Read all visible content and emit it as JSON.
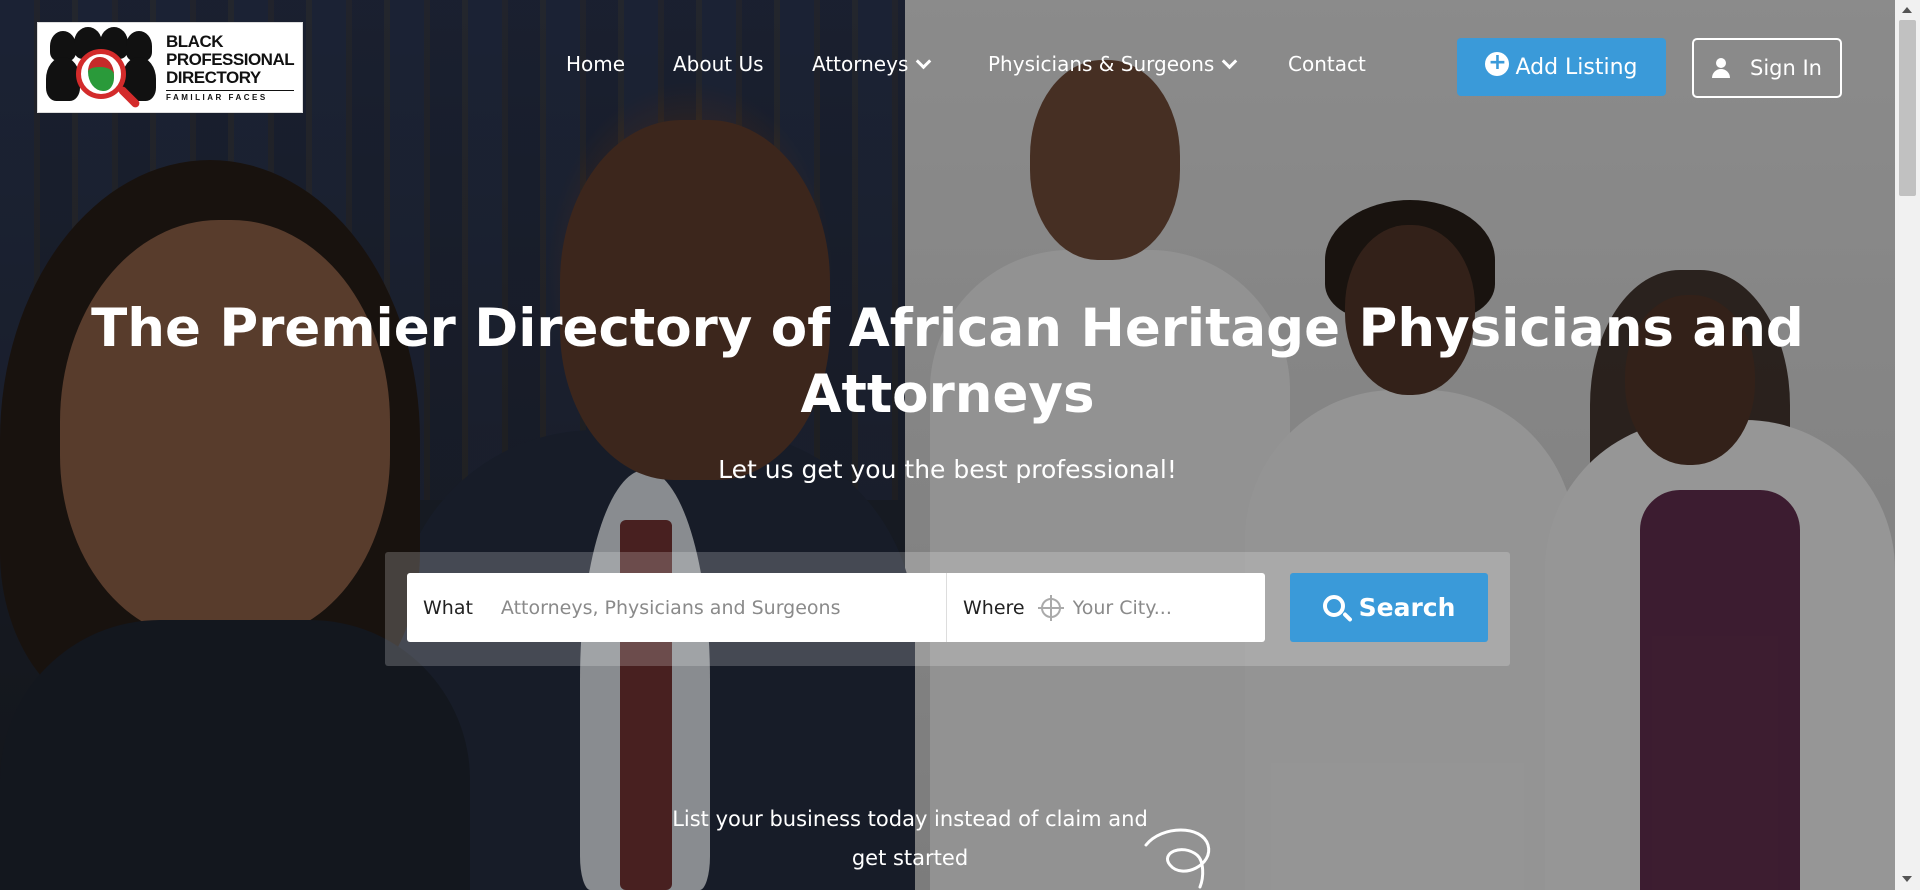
{
  "logo": {
    "line1": "BLACK",
    "line2": "PROFESSIONAL",
    "line3": "DIRECTORY",
    "line4": "FAMILIAR FACES"
  },
  "nav": {
    "items": [
      {
        "label": "Home",
        "dropdown": false
      },
      {
        "label": "About Us",
        "dropdown": false
      },
      {
        "label": "Attorneys",
        "dropdown": true
      },
      {
        "label": "Physicians & Surgeons",
        "dropdown": true
      },
      {
        "label": "Contact",
        "dropdown": false
      }
    ]
  },
  "header": {
    "add_listing_label": "Add Listing",
    "sign_in_label": "Sign In"
  },
  "hero": {
    "title": "The Premier Directory of African Heritage Physicians and Attorneys",
    "subtitle": "Let us get you the best professional!"
  },
  "search": {
    "what_label": "What",
    "what_placeholder": "Attorneys, Physicians and Surgeons",
    "where_label": "Where",
    "where_placeholder": "Your City...",
    "button_label": "Search"
  },
  "cta": {
    "text": "List your business today instead of claim and get started"
  },
  "colors": {
    "accent": "#3a9ad9",
    "text_light": "#ffffff"
  },
  "icons": [
    "plus-circle-icon",
    "user-icon",
    "chevron-down-icon",
    "crosshair-icon",
    "search-icon",
    "swirl-arrow-icon"
  ]
}
